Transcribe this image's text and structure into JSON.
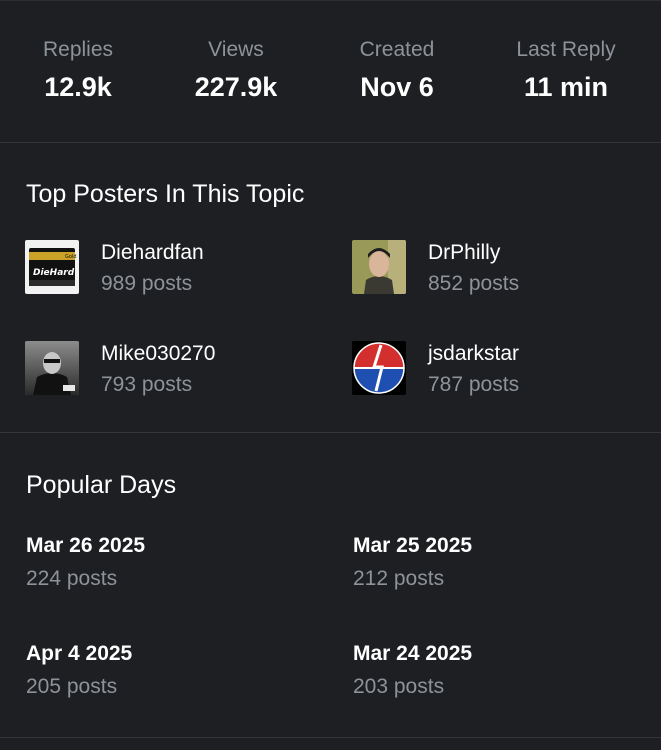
{
  "stats": [
    {
      "label": "Replies",
      "value": "12.9k"
    },
    {
      "label": "Views",
      "value": "227.9k"
    },
    {
      "label": "Created",
      "value": "Nov 6"
    },
    {
      "label": "Last Reply",
      "value": "11 min"
    }
  ],
  "top_posters": {
    "title": "Top Posters In This Topic",
    "items": [
      {
        "name": "Diehardfan",
        "posts": "989 posts",
        "avatar_text": "DieHard",
        "avatar_badge": "Gold"
      },
      {
        "name": "DrPhilly",
        "posts": "852 posts"
      },
      {
        "name": "Mike030270",
        "posts": "793 posts"
      },
      {
        "name": "jsdarkstar",
        "posts": "787 posts"
      }
    ]
  },
  "popular_days": {
    "title": "Popular Days",
    "items": [
      {
        "date": "Mar 26 2025",
        "posts": "224 posts"
      },
      {
        "date": "Mar 25 2025",
        "posts": "212 posts"
      },
      {
        "date": "Apr 4 2025",
        "posts": "205 posts"
      },
      {
        "date": "Mar 24 2025",
        "posts": "203 posts"
      }
    ]
  },
  "colors": {
    "background": "#1d1f23",
    "text_primary": "#ffffff",
    "text_secondary": "#8e9399",
    "divider": "#33363b"
  }
}
